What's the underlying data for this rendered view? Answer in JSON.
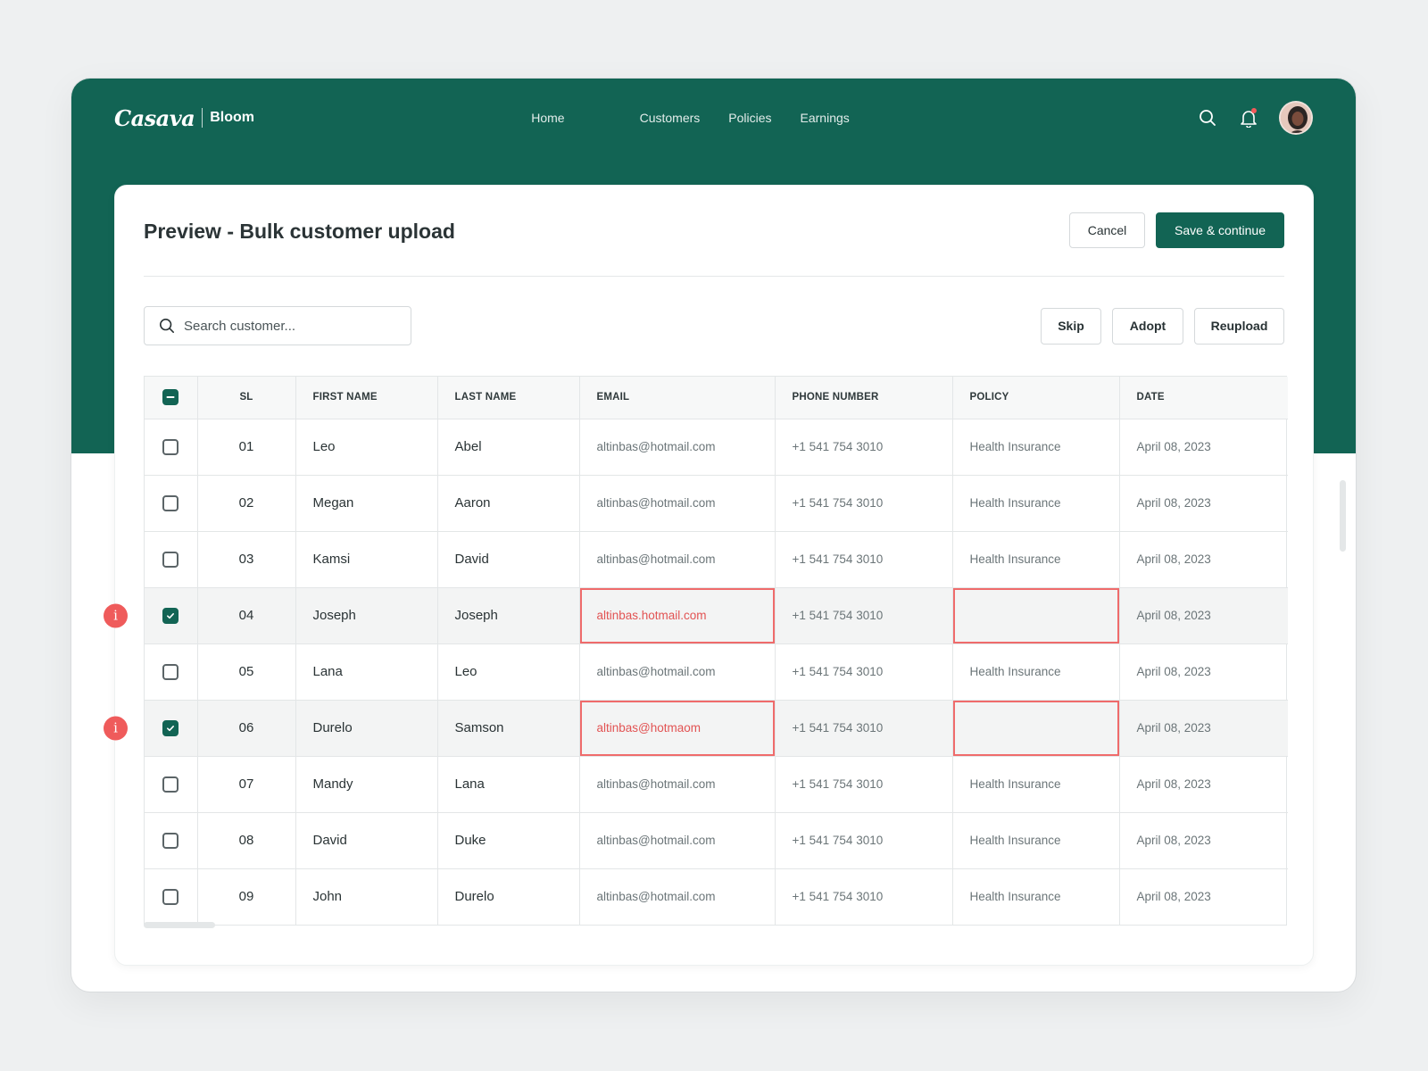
{
  "brand": {
    "logo": "Casava",
    "product": "Bloom"
  },
  "nav": [
    "Home",
    "Customers",
    "Policies",
    "Earnings"
  ],
  "page": {
    "title": "Preview - Bulk customer upload",
    "cancel_label": "Cancel",
    "save_label": "Save & continue"
  },
  "search": {
    "placeholder": "Search customer..."
  },
  "toolbar": {
    "skip_label": "Skip",
    "adopt_label": "Adopt",
    "reupload_label": "Reupload"
  },
  "table": {
    "columns": [
      "SL",
      "FIRST NAME",
      "LAST NAME",
      "EMAIL",
      "PHONE NUMBER",
      "POLICY",
      "DATE"
    ],
    "rows": [
      {
        "sl": "01",
        "first": "Leo",
        "last": "Abel",
        "email": "altinbas@hotmail.com",
        "phone": "+1 541 754 3010",
        "policy": "Health Insurance",
        "date": "April 08, 2023",
        "checked": false,
        "error": false
      },
      {
        "sl": "02",
        "first": "Megan",
        "last": "Aaron",
        "email": "altinbas@hotmail.com",
        "phone": "+1 541 754 3010",
        "policy": "Health Insurance",
        "date": "April 08, 2023",
        "checked": false,
        "error": false
      },
      {
        "sl": "03",
        "first": "Kamsi",
        "last": "David",
        "email": "altinbas@hotmail.com",
        "phone": "+1 541 754 3010",
        "policy": "Health Insurance",
        "date": "April 08, 2023",
        "checked": false,
        "error": false
      },
      {
        "sl": "04",
        "first": "Joseph",
        "last": "Joseph",
        "email": "altinbas.hotmail.com",
        "phone": "+1 541 754 3010",
        "policy": "",
        "date": "April 08, 2023",
        "checked": true,
        "error": true
      },
      {
        "sl": "05",
        "first": "Lana",
        "last": "Leo",
        "email": "altinbas@hotmail.com",
        "phone": "+1 541 754 3010",
        "policy": "Health Insurance",
        "date": "April 08, 2023",
        "checked": false,
        "error": false
      },
      {
        "sl": "06",
        "first": "Durelo",
        "last": "Samson",
        "email": "altinbas@hotmaom",
        "phone": "+1 541 754 3010",
        "policy": "",
        "date": "April 08, 2023",
        "checked": true,
        "error": true
      },
      {
        "sl": "07",
        "first": "Mandy",
        "last": "Lana",
        "email": "altinbas@hotmail.com",
        "phone": "+1 541 754 3010",
        "policy": "Health Insurance",
        "date": "April 08, 2023",
        "checked": false,
        "error": false
      },
      {
        "sl": "08",
        "first": "David",
        "last": "Duke",
        "email": "altinbas@hotmail.com",
        "phone": "+1 541 754 3010",
        "policy": "Health Insurance",
        "date": "April 08, 2023",
        "checked": false,
        "error": false
      },
      {
        "sl": "09",
        "first": "John",
        "last": "Durelo",
        "email": "altinbas@hotmail.com",
        "phone": "+1 541 754 3010",
        "policy": "Health Insurance",
        "date": "April 08, 2023",
        "checked": false,
        "error": false
      }
    ]
  },
  "colors": {
    "brand_green": "#126454",
    "error_red": "#ef5b5b"
  },
  "icons": [
    "search-icon",
    "bell-icon",
    "avatar",
    "check-icon",
    "info-icon"
  ]
}
